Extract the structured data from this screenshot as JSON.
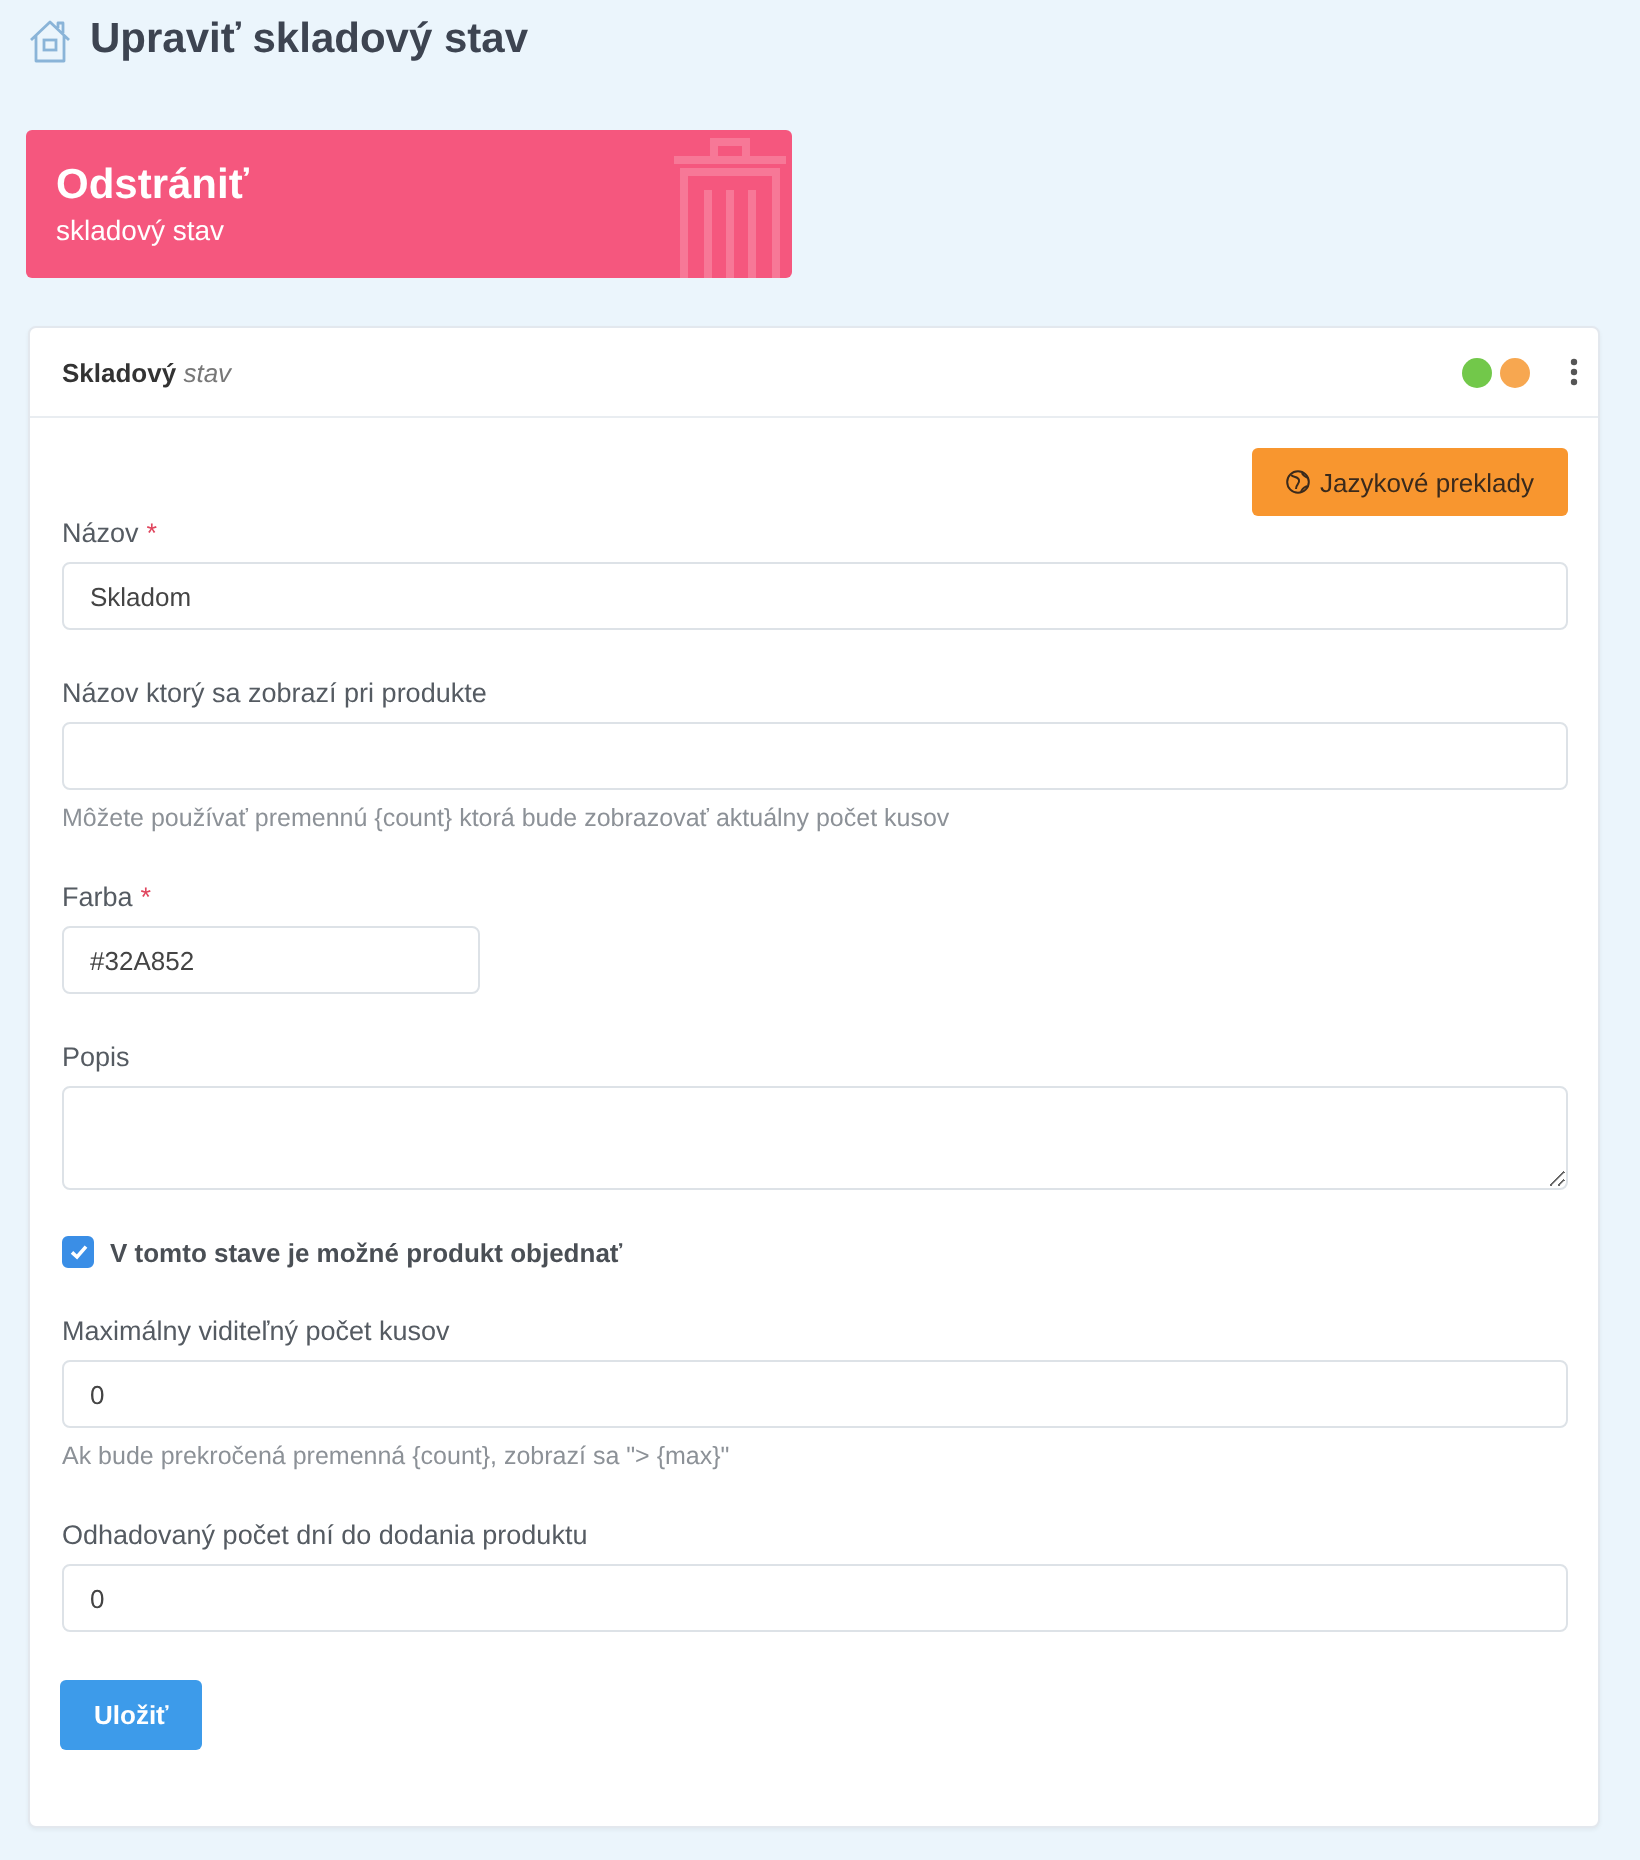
{
  "page": {
    "title": "Upraviť skladový stav"
  },
  "delete_banner": {
    "title": "Odstrániť",
    "subtitle": "skladový stav"
  },
  "card": {
    "title": "**Skladový** *stav*",
    "status_dots": [
      {
        "color": "#72c84a"
      },
      {
        "color": "#f7a750"
      }
    ]
  },
  "translations_button": {
    "label": "Jazykové preklady"
  },
  "fields": [
    {
      "kind": "input",
      "label": "Názov",
      "required_mark": "*",
      "value": "Skladom"
    },
    {
      "kind": "input",
      "label": "Názov ktorý sa zobrazí pri produkte",
      "help": "Môžete používať premennú {count} ktorá bude zobrazovať aktuálny počet kusov"
    },
    {
      "kind": "color",
      "label": "Farba",
      "required_mark": "*",
      "value": "#32A852"
    },
    {
      "kind": "textarea",
      "label": "Popis"
    },
    {
      "kind": "checkbox",
      "label": "V tomto stave je možné produkt objednať",
      "checked": true
    },
    {
      "kind": "input",
      "label": "Maximálny viditeľný počet kusov",
      "value": "0",
      "help": "Ak bude prekročená premenná {count}, zobrazí sa \"> {max}\""
    },
    {
      "kind": "input",
      "label": "Odhadovaný počet dní do dodania produktu",
      "value": "0"
    }
  ],
  "save_button": {
    "label": "Uložiť"
  }
}
